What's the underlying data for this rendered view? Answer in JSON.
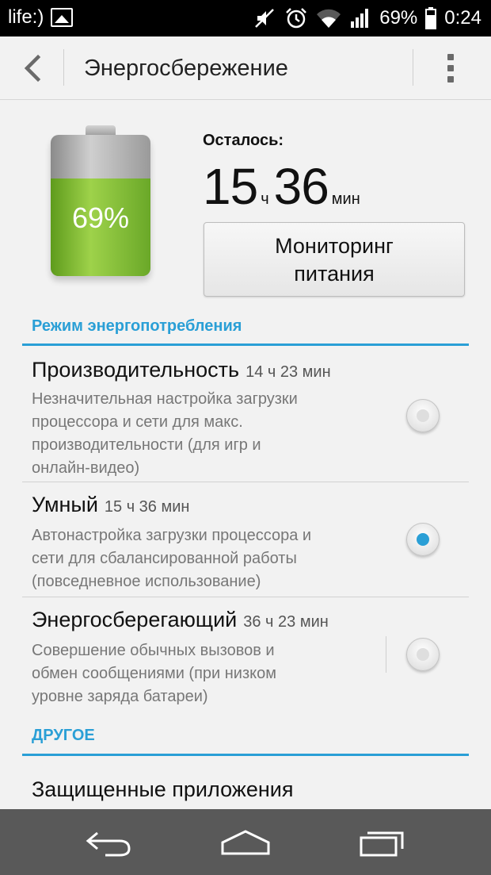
{
  "status_bar": {
    "carrier": "life:)",
    "battery_percent": "69%",
    "time": "0:24",
    "icons": [
      "image-icon",
      "mute-icon",
      "alarm-icon",
      "wifi-icon",
      "signal-icon",
      "battery-icon"
    ]
  },
  "app_bar": {
    "title": "Энергосбережение",
    "back_icon": "back-arrow-icon",
    "more_icon": "overflow-menu-icon"
  },
  "battery": {
    "level": 0.69,
    "label": "69%",
    "colors": {
      "fill": "#8cc63f",
      "body": "#b8b8b8"
    }
  },
  "remaining": {
    "label": "Осталось:",
    "hours": "15",
    "hours_unit": "ч",
    "minutes": "36",
    "minutes_unit": "мин"
  },
  "monitor_button": {
    "line1": "Мониторинг",
    "line2": "питания"
  },
  "power_mode_section": {
    "header": "Режим энергопотребления",
    "modes": [
      {
        "title": "Производительность",
        "time": "14 ч 23 мин",
        "desc": [
          "Незначительная настройка загрузки",
          "процессора и сети для макс.",
          "производительности (для игр и",
          "онлайн-видео)"
        ],
        "selected": false
      },
      {
        "title": "Умный",
        "time": "15 ч 36 мин",
        "desc": [
          "Автонастройка загрузки процессора и",
          "сети для сбалансированной работы",
          "(повседневное использование)"
        ],
        "selected": true
      },
      {
        "title": "Энергосберегающий",
        "time": "36 ч 23 мин",
        "desc": [
          "Совершение обычных вызовов и",
          "обмен сообщениями (при низком",
          "уровне заряда батареи)"
        ],
        "selected": false
      }
    ]
  },
  "other_section": {
    "header": "ДРУГОЕ",
    "items": [
      "Защищенные приложения"
    ]
  },
  "nav_bar": {
    "buttons": [
      "back-nav-icon",
      "home-nav-icon",
      "recents-nav-icon"
    ]
  },
  "colors": {
    "accent": "#2a9fd6",
    "background": "#f2f2f2",
    "nav_bar": "#595959"
  }
}
